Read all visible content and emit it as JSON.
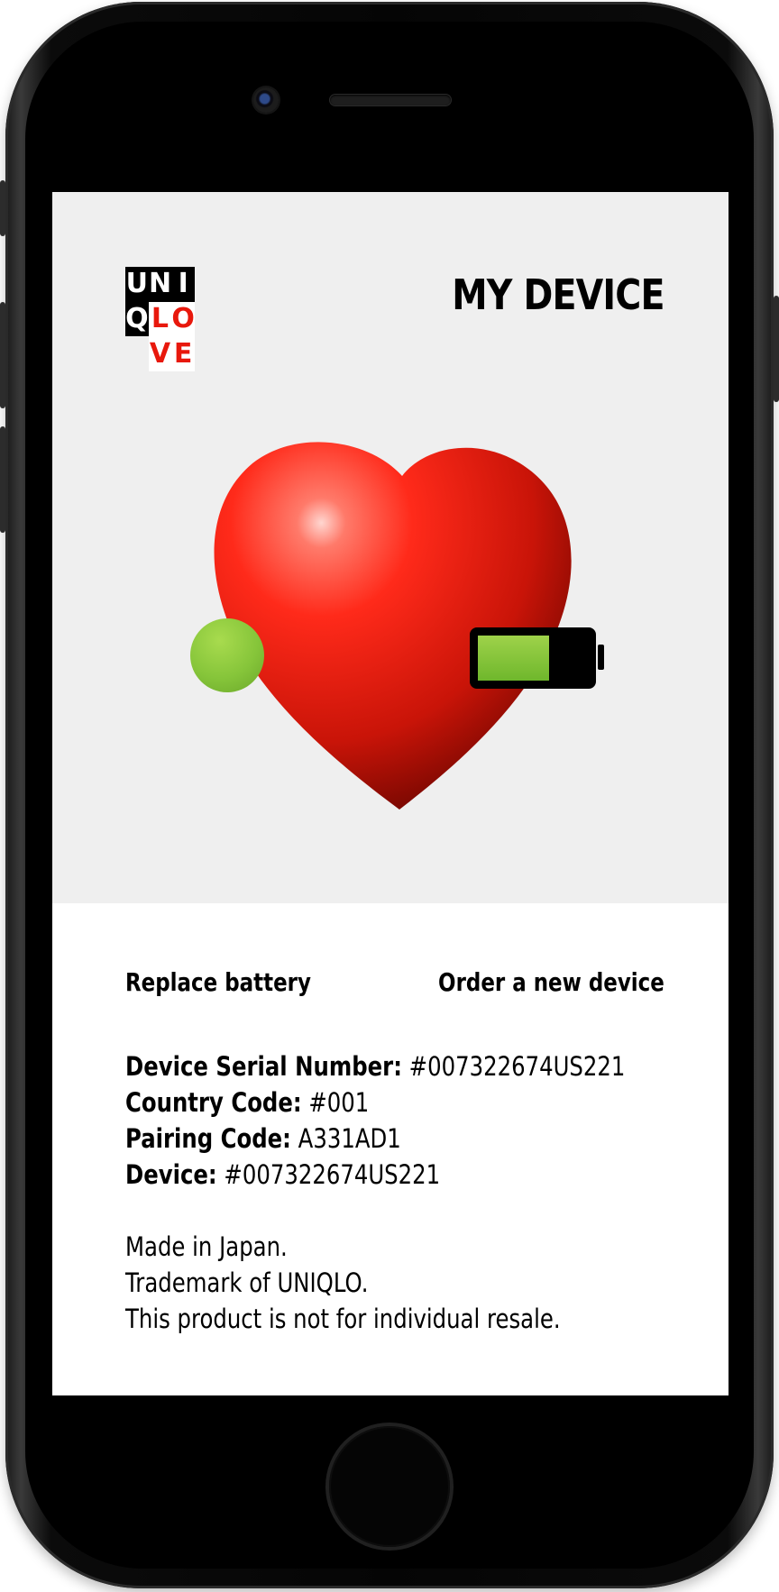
{
  "logo": {
    "rows": [
      [
        "U",
        "N",
        "I"
      ],
      [
        "Q",
        "L",
        "O"
      ],
      [
        "",
        "V",
        "E"
      ]
    ]
  },
  "header": {
    "title": "MY DEVICE"
  },
  "device_status": {
    "battery_level": 0.65,
    "status_color": "#86c53a",
    "heart_color": "#e8180c"
  },
  "actions": {
    "replace_battery": "Replace battery",
    "order_new_device": "Order a new device"
  },
  "details": {
    "serial_label": "Device Serial Number:",
    "serial_value": " #007322674US221",
    "country_label": "Country Code:",
    "country_value": " #001",
    "pairing_label": "Pairing Code:",
    "pairing_value": " A331AD1",
    "device_label": "Device:",
    "device_value": " #007322674US221"
  },
  "footer": {
    "line1": "Made in Japan.",
    "line2": "Trademark of UNIQLO.",
    "line3": "This product is not for individual resale."
  }
}
